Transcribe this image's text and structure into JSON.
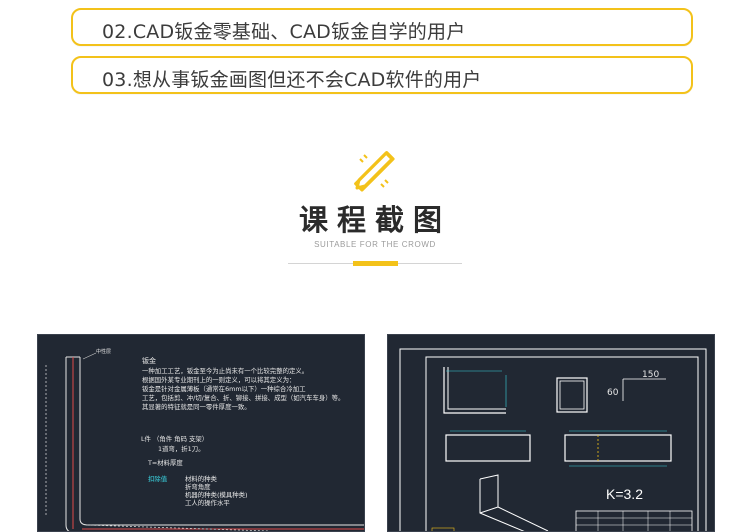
{
  "audience": {
    "items": [
      "02.CAD钣金零基础、CAD钣金自学的用户",
      "03.想从事钣金画图但还不会CAD软件的用户"
    ]
  },
  "section": {
    "title": "课程截图",
    "subtitle": "SUITABLE FOR THE CROWD",
    "icon": "pencil-ruler-icon",
    "accent_color": "#f3c21a"
  },
  "screenshot_left": {
    "small_label": "中性层",
    "heading": "钣金",
    "paragraph": [
      "一种加工工艺，钣金至今为止尚未有一个比较完整的定义。",
      "根据国外某专业期刊上的一则定义，可以将其定义为：",
      "钣金是针对金属薄板（通常在6mm以下）一种综合冷加工",
      "工艺，包括剪、冲/切/复合、折、铆接、拼接、成型（如汽车车身）等。",
      "其显著的特征就是同一零件厚度一致。"
    ],
    "lpart": "L件  （角件  角码    支架）",
    "lpart_sub": "1道弯，折1刀。",
    "thickness": "T=材料厚度",
    "deduction_label": "扣除值",
    "deduction_items": [
      "材料的种类",
      "折弯角度",
      "机器的种类(模具种类)",
      "工人的操作水平"
    ]
  },
  "screenshot_right": {
    "dim_150": "150",
    "dim_60": "60",
    "k_value": "K=3.2"
  }
}
